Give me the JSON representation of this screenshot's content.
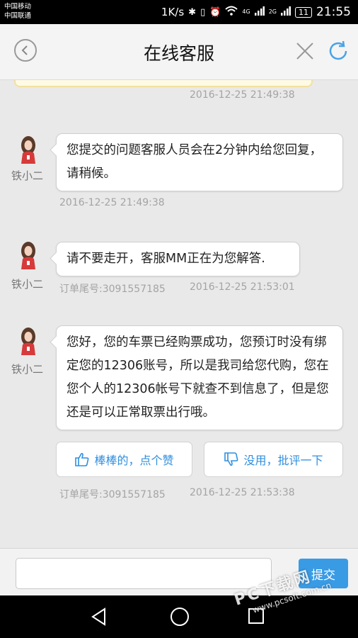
{
  "status_bar": {
    "carrier1": "中国移动",
    "carrier2": "中国联通",
    "speed": "1K/s",
    "net_4g": "4G",
    "net_2g": "2G",
    "battery": "11",
    "time": "21:55"
  },
  "header": {
    "title": "在线客服",
    "back_icon": "chevron-left",
    "close_icon": "close",
    "refresh_icon": "refresh"
  },
  "messages": [
    {
      "timestamp": "2016-12-25 21:49:38"
    },
    {
      "sender": "铁小二",
      "text": "您提交的问题客服人员会在2分钟内给您回复，请稍候。",
      "timestamp": "2016-12-25 21:49:38"
    },
    {
      "sender": "铁小二",
      "text": "请不要走开，客服MM正在为您解答.",
      "order_no": "订单尾号:3091557185",
      "timestamp": "2016-12-25 21:53:01"
    },
    {
      "sender": "铁小二",
      "text": "您好，您的车票已经购票成功，您预订时没有绑定您的12306账号，所以是我司给您代购，您在您个人的12306帐号下就查不到信息了，但是您还是可以正常取票出行哦。",
      "order_no": "订单尾号:3091557185",
      "timestamp": "2016-12-25 21:53:38"
    }
  ],
  "feedback": {
    "like_label": "棒棒的，点个赞",
    "dislike_label": "没用，批评一下"
  },
  "input": {
    "value": "",
    "placeholder": "",
    "submit_label": "提交"
  },
  "watermark": {
    "brand": "PC下载网",
    "url": "www.pcsoft.com.cn"
  },
  "colors": {
    "accent": "#3a9be5",
    "link": "#2f8fe0",
    "background": "#e9e9e9"
  }
}
